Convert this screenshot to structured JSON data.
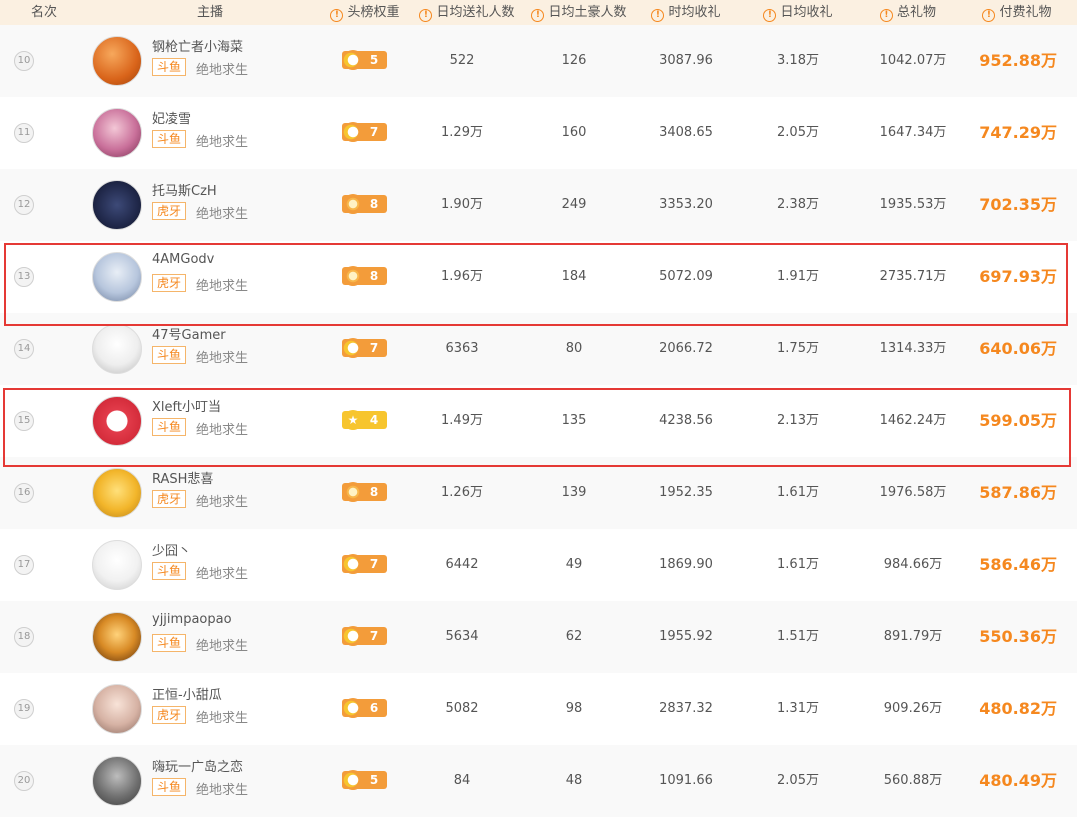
{
  "headers": {
    "rank": "名次",
    "anchor": "主播",
    "weight": "头榜权重",
    "daily_gifters": "日均送礼人数",
    "daily_tycoons": "日均土豪人数",
    "hourly_gifts": "时均收礼",
    "daily_gifts": "日均收礼",
    "total_gifts": "总礼物",
    "paid_gifts": "付费礼物"
  },
  "colors": {
    "accent": "#f5881f",
    "highlight_border": "#e53935",
    "badge_orange": "#f39c3a",
    "badge_yellow": "#f7c52e"
  },
  "rows": [
    {
      "rank": "10",
      "name": "钢枪亡者小海菜",
      "platform": "斗鱼",
      "game": "绝地求生",
      "level": "5",
      "badge_type": "moon",
      "daily_gifters": "522",
      "daily_tycoons": "126",
      "hourly": "3087.96",
      "daily": "3.18万",
      "total": "1042.07万",
      "paid": "952.88万"
    },
    {
      "rank": "11",
      "name": "妃凌雪",
      "platform": "斗鱼",
      "game": "绝地求生",
      "level": "7",
      "badge_type": "moon",
      "daily_gifters": "1.29万",
      "daily_tycoons": "160",
      "hourly": "3408.65",
      "daily": "2.05万",
      "total": "1647.34万",
      "paid": "747.29万"
    },
    {
      "rank": "12",
      "name": "托马斯CzH",
      "platform": "虎牙",
      "game": "绝地求生",
      "level": "8",
      "badge_type": "sun",
      "daily_gifters": "1.90万",
      "daily_tycoons": "249",
      "hourly": "3353.20",
      "daily": "2.38万",
      "total": "1935.53万",
      "paid": "702.35万"
    },
    {
      "rank": "13",
      "name": "4AMGodv",
      "platform": "虎牙",
      "game": "绝地求生",
      "level": "8",
      "badge_type": "sun",
      "daily_gifters": "1.96万",
      "daily_tycoons": "184",
      "hourly": "5072.09",
      "daily": "1.91万",
      "total": "2735.71万",
      "paid": "697.93万"
    },
    {
      "rank": "14",
      "name": "47号Gamer",
      "platform": "斗鱼",
      "game": "绝地求生",
      "level": "7",
      "badge_type": "moon",
      "daily_gifters": "6363",
      "daily_tycoons": "80",
      "hourly": "2066.72",
      "daily": "1.75万",
      "total": "1314.33万",
      "paid": "640.06万"
    },
    {
      "rank": "15",
      "name": "Xleft小叮当",
      "platform": "斗鱼",
      "game": "绝地求生",
      "level": "4",
      "badge_type": "star",
      "daily_gifters": "1.49万",
      "daily_tycoons": "135",
      "hourly": "4238.56",
      "daily": "2.13万",
      "total": "1462.24万",
      "paid": "599.05万"
    },
    {
      "rank": "16",
      "name": "RASH悲喜",
      "platform": "虎牙",
      "game": "绝地求生",
      "level": "8",
      "badge_type": "sun",
      "daily_gifters": "1.26万",
      "daily_tycoons": "139",
      "hourly": "1952.35",
      "daily": "1.61万",
      "total": "1976.58万",
      "paid": "587.86万"
    },
    {
      "rank": "17",
      "name": "少囧丶",
      "platform": "斗鱼",
      "game": "绝地求生",
      "level": "7",
      "badge_type": "moon",
      "daily_gifters": "6442",
      "daily_tycoons": "49",
      "hourly": "1869.90",
      "daily": "1.61万",
      "total": "984.66万",
      "paid": "586.46万"
    },
    {
      "rank": "18",
      "name": "yjjimpaopao",
      "platform": "斗鱼",
      "game": "绝地求生",
      "level": "7",
      "badge_type": "moon",
      "daily_gifters": "5634",
      "daily_tycoons": "62",
      "hourly": "1955.92",
      "daily": "1.51万",
      "total": "891.79万",
      "paid": "550.36万"
    },
    {
      "rank": "19",
      "name": "正恒-小甜瓜",
      "platform": "虎牙",
      "game": "绝地求生",
      "level": "6",
      "badge_type": "moon",
      "daily_gifters": "5082",
      "daily_tycoons": "98",
      "hourly": "2837.32",
      "daily": "1.31万",
      "total": "909.26万",
      "paid": "480.82万"
    },
    {
      "rank": "20",
      "name": "嗨玩一广岛之恋",
      "platform": "斗鱼",
      "game": "绝地求生",
      "level": "5",
      "badge_type": "moon",
      "daily_gifters": "84",
      "daily_tycoons": "48",
      "hourly": "1091.66",
      "daily": "2.05万",
      "total": "560.88万",
      "paid": "480.49万"
    }
  ]
}
